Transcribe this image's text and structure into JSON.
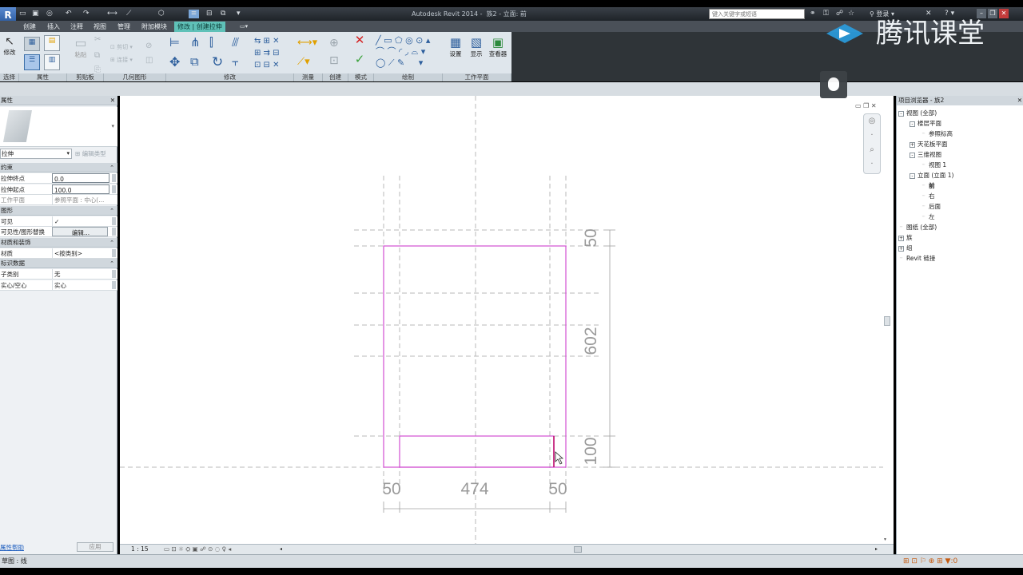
{
  "window": {
    "title": "Autodesk Revit 2014 -",
    "doc": "族2 - 立面: 前"
  },
  "search": {
    "placeholder": "键入关键字或短语"
  },
  "account": {
    "login": "登录"
  },
  "tabs": [
    "创建",
    "插入",
    "注释",
    "视图",
    "管理",
    "附加模块",
    "修改 | 创建拉伸"
  ],
  "ribbon": {
    "modify_label": "修改",
    "panels": [
      "选择",
      "属性",
      "剪贴板",
      "几何图形",
      "修改",
      "测量",
      "创建",
      "模式",
      "绘制",
      "工作平面"
    ],
    "workplane_buttons": [
      "设置",
      "显示",
      "查看器"
    ],
    "clipboard_items": [
      "粘贴",
      "剪切",
      "连接"
    ]
  },
  "properties": {
    "title": "属性",
    "type_selector": "拉伸",
    "edit_type": "编辑类型",
    "groups": [
      {
        "name": "约束",
        "rows": [
          {
            "k": "拉伸终点",
            "v": "0.0"
          },
          {
            "k": "拉伸起点",
            "v": "100.0"
          },
          {
            "k": "工作平面",
            "v": "参照平面 : 中心(..."
          }
        ]
      },
      {
        "name": "图形",
        "rows": [
          {
            "k": "可见",
            "v": "✓"
          },
          {
            "k": "可见性/图形替换",
            "v": "编辑..."
          }
        ]
      },
      {
        "name": "材质和装饰",
        "rows": [
          {
            "k": "材质",
            "v": "<按类别>"
          }
        ]
      },
      {
        "name": "标识数据",
        "rows": [
          {
            "k": "子类别",
            "v": "无"
          },
          {
            "k": "实心/空心",
            "v": "实心"
          }
        ]
      }
    ],
    "help_link": "属性帮助",
    "apply": "应用"
  },
  "browser": {
    "title": "项目浏览器 - 族2",
    "items": [
      {
        "label": "视图 (全部)",
        "level": 0,
        "tog": "-"
      },
      {
        "label": "楼层平面",
        "level": 1,
        "tog": "-"
      },
      {
        "label": "参照标高",
        "level": 2,
        "tog": ""
      },
      {
        "label": "天花板平面",
        "level": 1,
        "tog": "+"
      },
      {
        "label": "三维视图",
        "level": 1,
        "tog": "-"
      },
      {
        "label": "视图 1",
        "level": 2,
        "tog": ""
      },
      {
        "label": "立面 (立面 1)",
        "level": 1,
        "tog": "-"
      },
      {
        "label": "前",
        "level": 2,
        "tog": "",
        "bold": true
      },
      {
        "label": "右",
        "level": 2,
        "tog": ""
      },
      {
        "label": "后面",
        "level": 2,
        "tog": ""
      },
      {
        "label": "左",
        "level": 2,
        "tog": ""
      },
      {
        "label": "图纸 (全部)",
        "level": 0,
        "tog": ""
      },
      {
        "label": "族",
        "level": 0,
        "tog": "+"
      },
      {
        "label": "组",
        "level": 0,
        "tog": "+"
      },
      {
        "label": "Revit 链接",
        "level": 0,
        "tog": ""
      }
    ]
  },
  "drawing": {
    "dims_horizontal": [
      "50",
      "474",
      "50"
    ],
    "dims_vertical": [
      "50",
      "602",
      "100"
    ],
    "sketch_color": "#d24fd2"
  },
  "viewbar": {
    "scale": "1 : 15"
  },
  "status": {
    "text": "草图 : 线"
  },
  "watermark": {
    "text": "腾讯课堂"
  },
  "colors": {
    "accent_tab": "#5fc1b8",
    "titlebar": "#2a2f35"
  }
}
